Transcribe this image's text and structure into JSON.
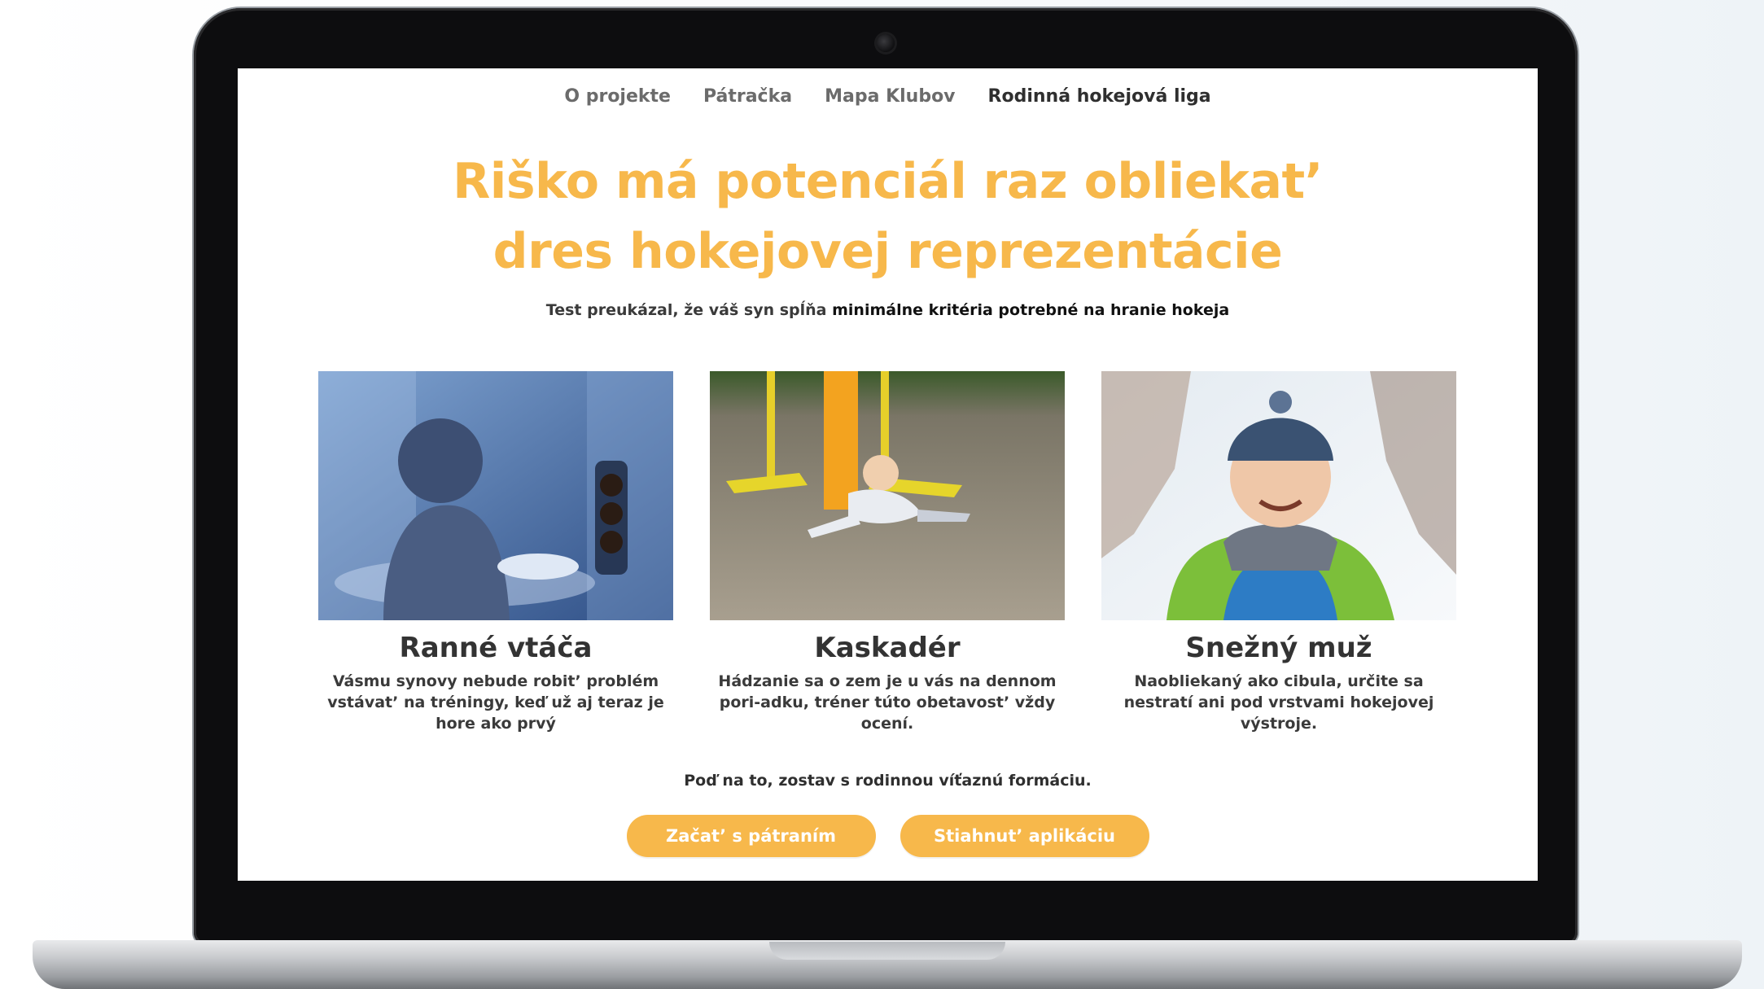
{
  "nav": {
    "items": [
      {
        "label": "O projekte"
      },
      {
        "label": "Pátračka"
      },
      {
        "label": "Mapa Klubov"
      },
      {
        "label": "Rodinná hokejová liga"
      }
    ]
  },
  "hero": {
    "headline_line1": "Riško má potenciál raz obliekat’",
    "headline_line2": "dres hokejovej reprezentácie",
    "subtitle_normal": "Test preukázal, že váš syn spĺňa ",
    "subtitle_strong": "minimálne kritéria potrebné na hranie hokeja"
  },
  "cards": [
    {
      "title": "Ranné vtáča",
      "text": "Vásmu synovy nebude robit’ problém vstávat’ na tréningy, keď už aj teraz je hore ako prvý"
    },
    {
      "title": "Kaskadér",
      "text": "Hádzanie sa o zem je u vás na dennom pori-adku, tréner túto obetavost’ vždy ocení."
    },
    {
      "title": "Snežný muž",
      "text": "Naobliekaný ako cibula, určite sa nestratí ani pod vrstvami hokejovej výstroje."
    }
  ],
  "cta": {
    "text": "Poď na to, zostav s rodinnou víťaznú formáciu.",
    "button_start": "Začat’ s pátraním",
    "button_download": "Stiahnut’ aplikáciu"
  },
  "colors": {
    "accent": "#f7b84b",
    "text_dark": "#2f2f2f"
  }
}
